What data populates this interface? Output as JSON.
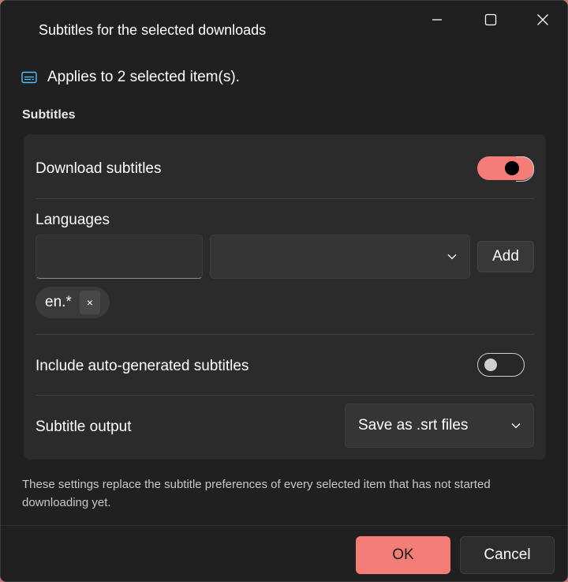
{
  "window": {
    "title": "Subtitles for the selected downloads",
    "caption_buttons": [
      "minimize-icon",
      "maximize-icon",
      "close-icon"
    ]
  },
  "info": {
    "icon": "subtitles-icon",
    "text": "Applies to 2 selected item(s)."
  },
  "section": {
    "label": "Subtitles"
  },
  "download_subtitles": {
    "label": "Download subtitles",
    "toggle_on": true
  },
  "languages": {
    "label": "Languages",
    "text_input_value": "",
    "select_value": "",
    "add_label": "Add",
    "chips": [
      {
        "text": "en.*",
        "remove_label": "×"
      }
    ]
  },
  "auto_generated": {
    "label": "Include auto-generated subtitles",
    "toggle_on": false
  },
  "output": {
    "label": "Subtitle output",
    "select_value": "Save as .srt files"
  },
  "footnote": "These settings replace the subtitle preferences of every selected item that has not started downloading yet.",
  "footer": {
    "ok_label": "OK",
    "cancel_label": "Cancel"
  },
  "colors": {
    "accent": "#f47d78",
    "dialog_bg": "#202020",
    "card_bg": "#2b2b2b",
    "info_icon": "#4cc2ff"
  }
}
